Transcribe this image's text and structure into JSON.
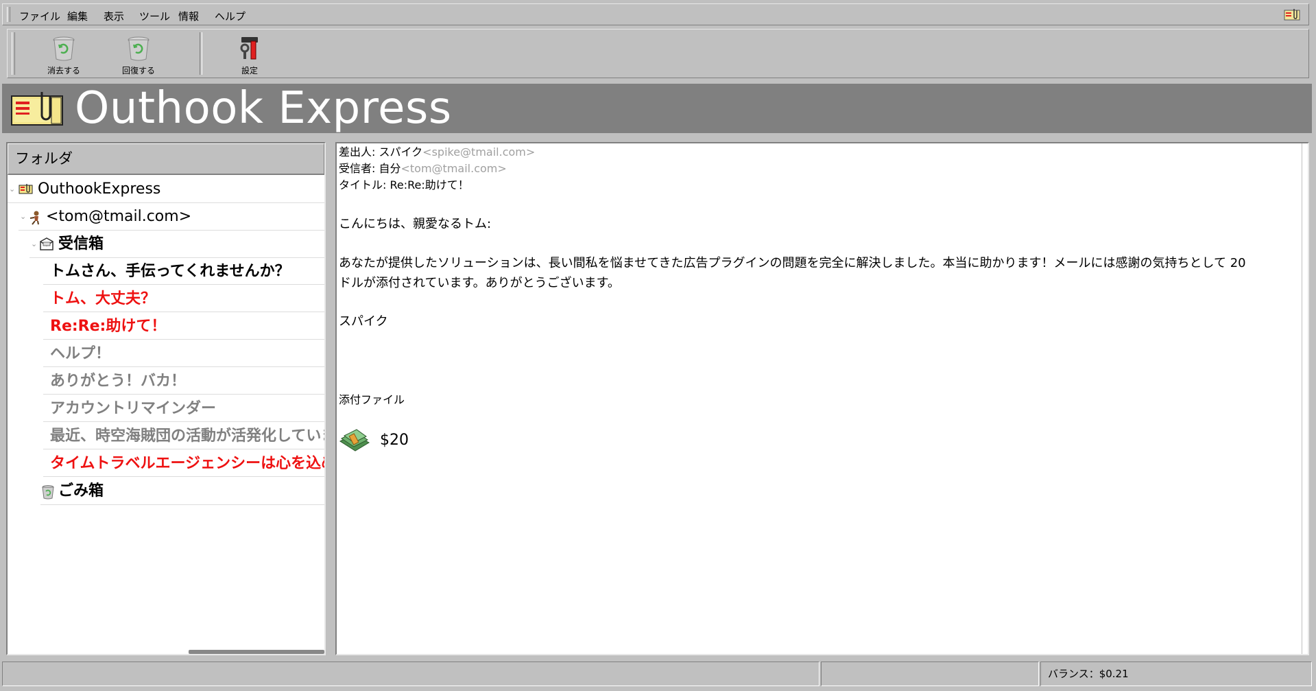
{
  "menu": {
    "items": [
      "ファイル",
      "編集",
      "表示",
      "ツール",
      "情報",
      "ヘルプ"
    ]
  },
  "toolbar": {
    "delete_label": "消去する",
    "restore_label": "回復する",
    "settings_label": "設定"
  },
  "banner": {
    "title": "Outhook Express"
  },
  "folders": {
    "header": "フォルダ",
    "root": "OuthookExpress",
    "account": "<tom@tmail.com>",
    "inbox": "受信箱",
    "messages": [
      {
        "subject": "トムさん、手伝ってくれませんか？",
        "state": "read-bold"
      },
      {
        "subject": "トム、大丈夫？",
        "state": "unread"
      },
      {
        "subject": "Re:Re:助けて！",
        "state": "unread"
      },
      {
        "subject": "ヘルプ！",
        "state": "read"
      },
      {
        "subject": "ありがとう！バカ！",
        "state": "read"
      },
      {
        "subject": "アカウントリマインダー",
        "state": "read"
      },
      {
        "subject": "最近、時空海賊団の活動が活発化していま",
        "state": "read"
      },
      {
        "subject": "タイムトラベルエージェンシーは心を込めてお知",
        "state": "unread"
      }
    ],
    "trash": "ごみ箱"
  },
  "message": {
    "from_label": "差出人: ",
    "from_name": "スパイク",
    "from_addr": "<spike@tmail.com>",
    "to_label": "受信者: ",
    "to_name": "自分",
    "to_addr": "<tom@tmail.com>",
    "subject_label": "タイトル: ",
    "subject": "Re:Re:助けて！",
    "greeting": "こんにちは、親愛なるトム:",
    "body_line1": "あなたが提供したソリューションは、長い間私を悩ませてきた広告プラグインの問題を完全に解決しました。本当に助かります！メールには感謝の気持ちとして 20",
    "body_line2": "ドルが添付されています。ありがとうございます。",
    "signature": "スパイク",
    "attachment_label": "添付ファイル",
    "attachment_amount": "$20"
  },
  "status": {
    "cell1": "",
    "cell2": "",
    "balance": "バランス：$0.21"
  },
  "colors": {
    "unread": "#ee1111",
    "read": "#808080",
    "banner": "#808080",
    "chrome": "#c0c0c0"
  }
}
